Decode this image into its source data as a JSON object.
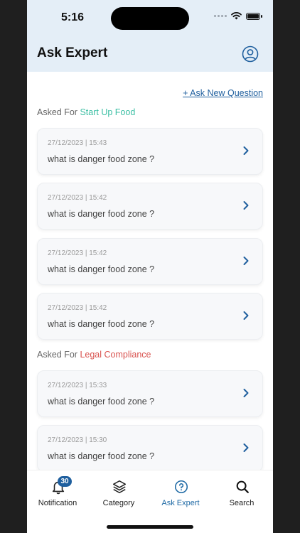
{
  "status": {
    "time": "5:16"
  },
  "header": {
    "title": "Ask Expert"
  },
  "actions": {
    "ask_new": "+ Ask New Question"
  },
  "sections": [
    {
      "prefix": "Asked For",
      "category": "Start Up Food",
      "category_color": "#3cbfa4",
      "items": [
        {
          "date": "27/12/2023 | 15:43",
          "question": "what is danger food zone ?"
        },
        {
          "date": "27/12/2023 | 15:42",
          "question": "what is danger food zone ?"
        },
        {
          "date": "27/12/2023 | 15:42",
          "question": "what is danger food zone ?"
        },
        {
          "date": "27/12/2023 | 15:42",
          "question": "what is danger food zone ?"
        }
      ]
    },
    {
      "prefix": "Asked For",
      "category": "Legal Compliance",
      "category_color": "#d9534f",
      "items": [
        {
          "date": "27/12/2023 | 15:33",
          "question": "what is danger food zone ?"
        },
        {
          "date": "27/12/2023 | 15:30",
          "question": "what is danger food zone ?"
        }
      ]
    }
  ],
  "tabs": [
    {
      "label": "Notification",
      "icon": "bell-icon",
      "badge": "30",
      "active": false
    },
    {
      "label": "Category",
      "icon": "layers-icon",
      "active": false
    },
    {
      "label": "Ask Expert",
      "icon": "question-circle-icon",
      "active": true
    },
    {
      "label": "Search",
      "icon": "search-icon",
      "active": false
    }
  ],
  "colors": {
    "header_bg": "#e4eef7",
    "accent": "#1f5f9e",
    "active_tab": "#1f6aa5"
  }
}
